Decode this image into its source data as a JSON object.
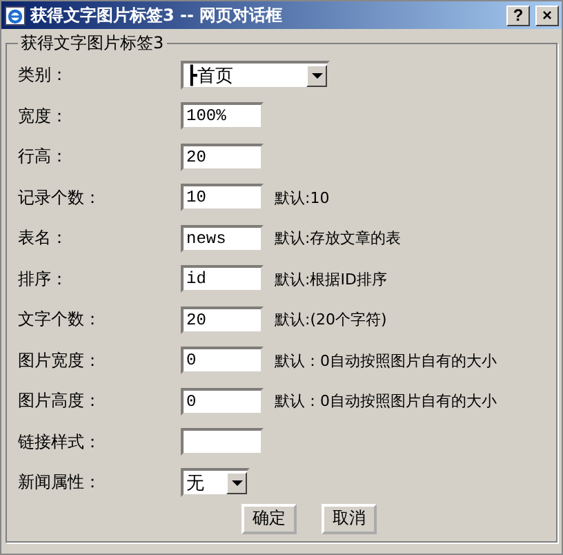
{
  "window": {
    "title": "获得文字图片标签3 -- 网页对话框",
    "help": "?",
    "close": "×"
  },
  "group": {
    "legend": "获得文字图片标签3"
  },
  "fields": [
    {
      "label": "类别：",
      "kind": "select",
      "value": "┣首页"
    },
    {
      "label": "宽度：",
      "kind": "text",
      "value": "100%"
    },
    {
      "label": "行高：",
      "kind": "text",
      "value": "20"
    },
    {
      "label": "记录个数：",
      "kind": "text",
      "value": "10",
      "note": "默认:10"
    },
    {
      "label": "表名：",
      "kind": "text",
      "value": "news",
      "note": "默认:存放文章的表"
    },
    {
      "label": "排序：",
      "kind": "text",
      "value": "id",
      "note": "默认:根据ID排序"
    },
    {
      "label": "文字个数：",
      "kind": "text",
      "value": "20",
      "note": "默认:(20个字符)"
    },
    {
      "label": "图片宽度：",
      "kind": "text",
      "value": "0",
      "note": "默认：0自动按照图片自有的大小"
    },
    {
      "label": "图片高度：",
      "kind": "text",
      "value": "0",
      "note": "默认：0自动按照图片自有的大小"
    },
    {
      "label": "链接样式：",
      "kind": "text"
    },
    {
      "label": "新闻属性：",
      "kind": "miniselect",
      "value": "无"
    }
  ],
  "buttons": [
    "确定",
    "取消"
  ]
}
